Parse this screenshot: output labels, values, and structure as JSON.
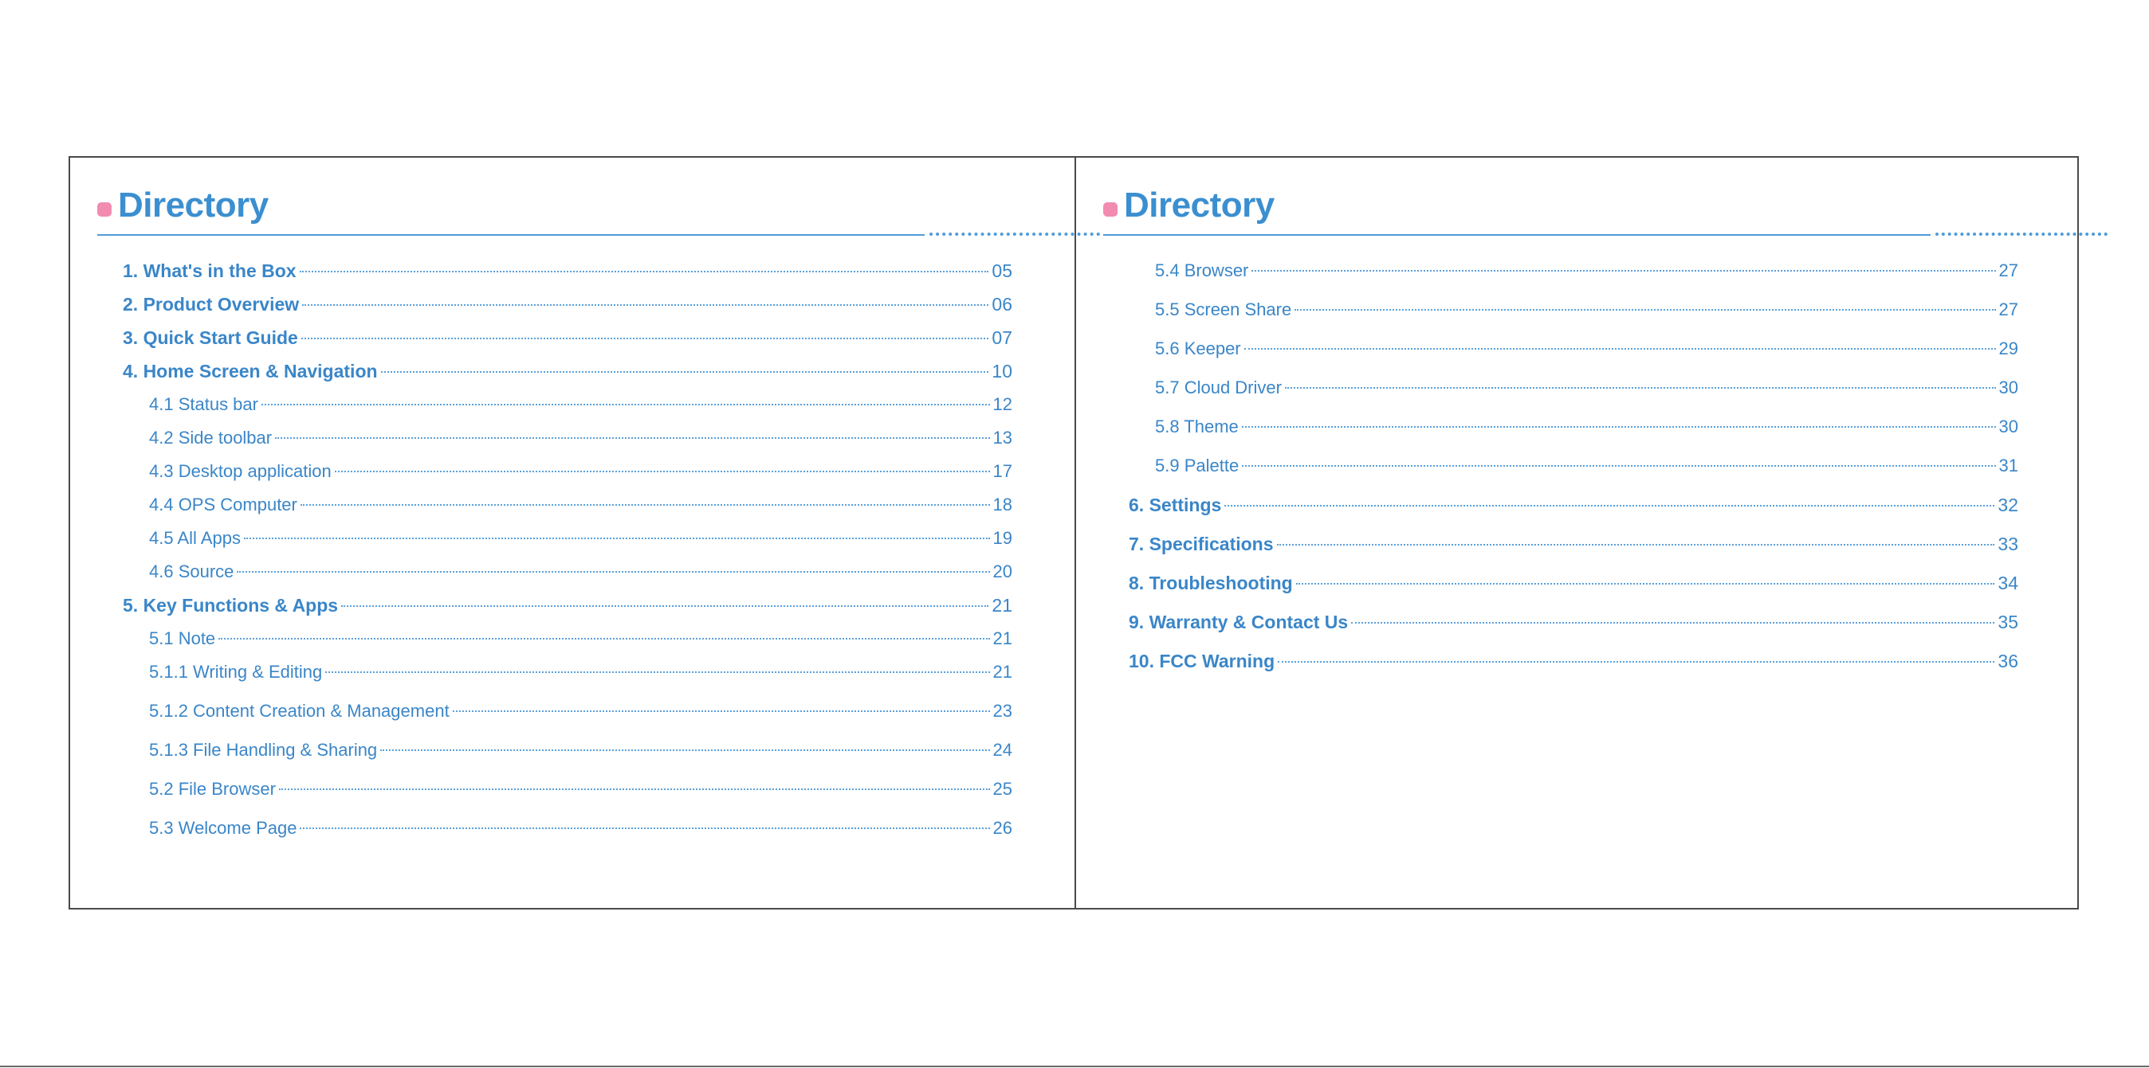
{
  "left_page": {
    "heading": "Directory",
    "entries": [
      {
        "label": "1. What's in the Box",
        "page": "05",
        "level": 1
      },
      {
        "label": "2. Product Overview",
        "page": "06",
        "level": 1
      },
      {
        "label": "3. Quick Start Guide",
        "page": "07",
        "level": 1
      },
      {
        "label": "4. Home Screen & Navigation",
        "page": "10",
        "level": 1
      },
      {
        "label": "4.1 Status bar",
        "page": "12",
        "level": 2
      },
      {
        "label": "4.2 Side toolbar",
        "page": "13",
        "level": 2
      },
      {
        "label": "4.3  Desktop application",
        "page": "17",
        "level": 2
      },
      {
        "label": "4.4 OPS Computer",
        "page": "18",
        "level": 2
      },
      {
        "label": "4.5  All Apps",
        "page": "19",
        "level": 2
      },
      {
        "label": "4.6 Source",
        "page": "20",
        "level": 2
      },
      {
        "label": "5. Key Functions & Apps",
        "page": "21",
        "level": 1
      },
      {
        "label": "5.1 Note",
        "page": "21",
        "level": 2
      },
      {
        "label": "5.1.1 Writing & Editing",
        "page": "21",
        "level": 2
      },
      {
        "label": "5.1.2 Content Creation & Management",
        "page": "23",
        "level": 2
      },
      {
        "label": "5.1.3 File Handling & Sharing",
        "page": "24",
        "level": 2
      },
      {
        "label": "5.2 File Browser",
        "page": "25",
        "level": 2
      },
      {
        "label": "5.3 Welcome Page",
        "page": "26",
        "level": 2
      }
    ]
  },
  "right_page": {
    "heading": "Directory",
    "entries": [
      {
        "label": "5.4 Browser",
        "page": "27",
        "level": 2
      },
      {
        "label": "5.5 Screen Share",
        "page": "27",
        "level": 2
      },
      {
        "label": "5.6 Keeper",
        "page": "29",
        "level": 2
      },
      {
        "label": "5.7 Cloud Driver",
        "page": "30",
        "level": 2
      },
      {
        "label": "5.8 Theme",
        "page": "30",
        "level": 2
      },
      {
        "label": "5.9 Palette",
        "page": "31",
        "level": 2
      },
      {
        "label": "6. Settings",
        "page": "32",
        "level": 1
      },
      {
        "label": "7. Specifications",
        "page": "33",
        "level": 1
      },
      {
        "label": "8. Troubleshooting",
        "page": "34",
        "level": 1
      },
      {
        "label": "9. Warranty & Contact Us",
        "page": "35",
        "level": 1
      },
      {
        "label": "10. FCC Warning",
        "page": "36",
        "level": 1
      }
    ]
  },
  "colors": {
    "heading": "#3b8fd0",
    "text": "#3a86c8",
    "bullet": "#f28bb0",
    "border": "#4a4a4a"
  }
}
